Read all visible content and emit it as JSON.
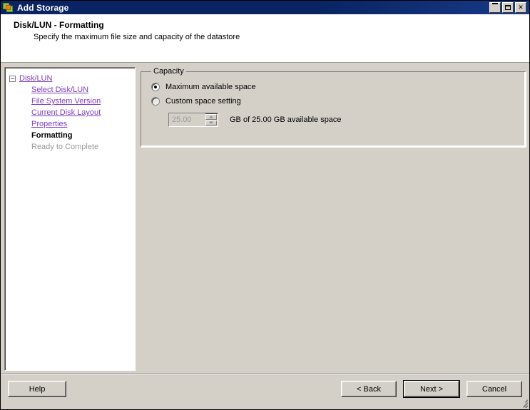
{
  "window": {
    "title": "Add Storage",
    "icon": "vmware-app-icon",
    "controls": {
      "minimize": "Minimize",
      "maximize": "Maximize",
      "close": "Close"
    }
  },
  "header": {
    "title": "Disk/LUN - Formatting",
    "subtitle": "Specify the maximum file size and capacity of the datastore"
  },
  "wizard_tree": {
    "root": {
      "label": "Disk/LUN",
      "state": "link",
      "expander": "minus-box"
    },
    "steps": [
      {
        "label": "Select Disk/LUN",
        "state": "link"
      },
      {
        "label": "File System Version",
        "state": "link"
      },
      {
        "label": "Current Disk Layout",
        "state": "link"
      },
      {
        "label": "Properties",
        "state": "link"
      },
      {
        "label": "Formatting",
        "state": "current"
      },
      {
        "label": "Ready to Complete",
        "state": "future"
      }
    ]
  },
  "capacity": {
    "legend": "Capacity",
    "options": [
      {
        "label": "Maximum available space",
        "selected": true
      },
      {
        "label": "Custom space setting",
        "selected": false
      }
    ],
    "spinner": {
      "value": "25.00",
      "enabled": false,
      "up_icon": "spin-up-arrow",
      "down_icon": "spin-down-arrow"
    },
    "spinner_suffix": "GB of 25.00 GB available space"
  },
  "footer": {
    "help": "Help",
    "back": "< Back",
    "next": "Next >",
    "cancel": "Cancel",
    "default_button": "Next >"
  },
  "colors": {
    "titlebar": "#0a2463",
    "face": "#d4d0c8",
    "link": "#8040c0",
    "disabled_text": "#9a9a9a"
  }
}
